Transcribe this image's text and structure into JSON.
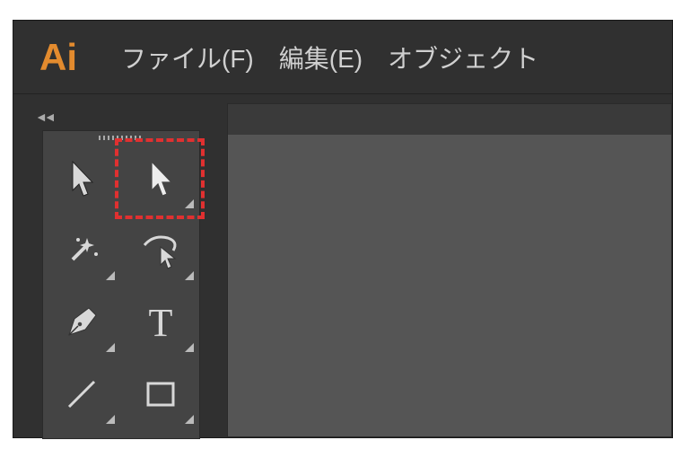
{
  "app": {
    "logo_text": "Ai"
  },
  "menu": {
    "file": "ファイル(F)",
    "edit": "編集(E)",
    "object": "オブジェクト"
  },
  "tools": {
    "panel_collapse": "◄◄",
    "icons": {
      "selection": "selection-tool",
      "direct_selection": "direct-selection-tool",
      "magic_wand": "magic-wand-tool",
      "lasso": "lasso-tool",
      "pen": "pen-tool",
      "type": "type-tool",
      "line": "line-segment-tool",
      "rectangle": "rectangle-tool"
    },
    "type_glyph": "T"
  },
  "highlight": {
    "color": "#e03030"
  }
}
